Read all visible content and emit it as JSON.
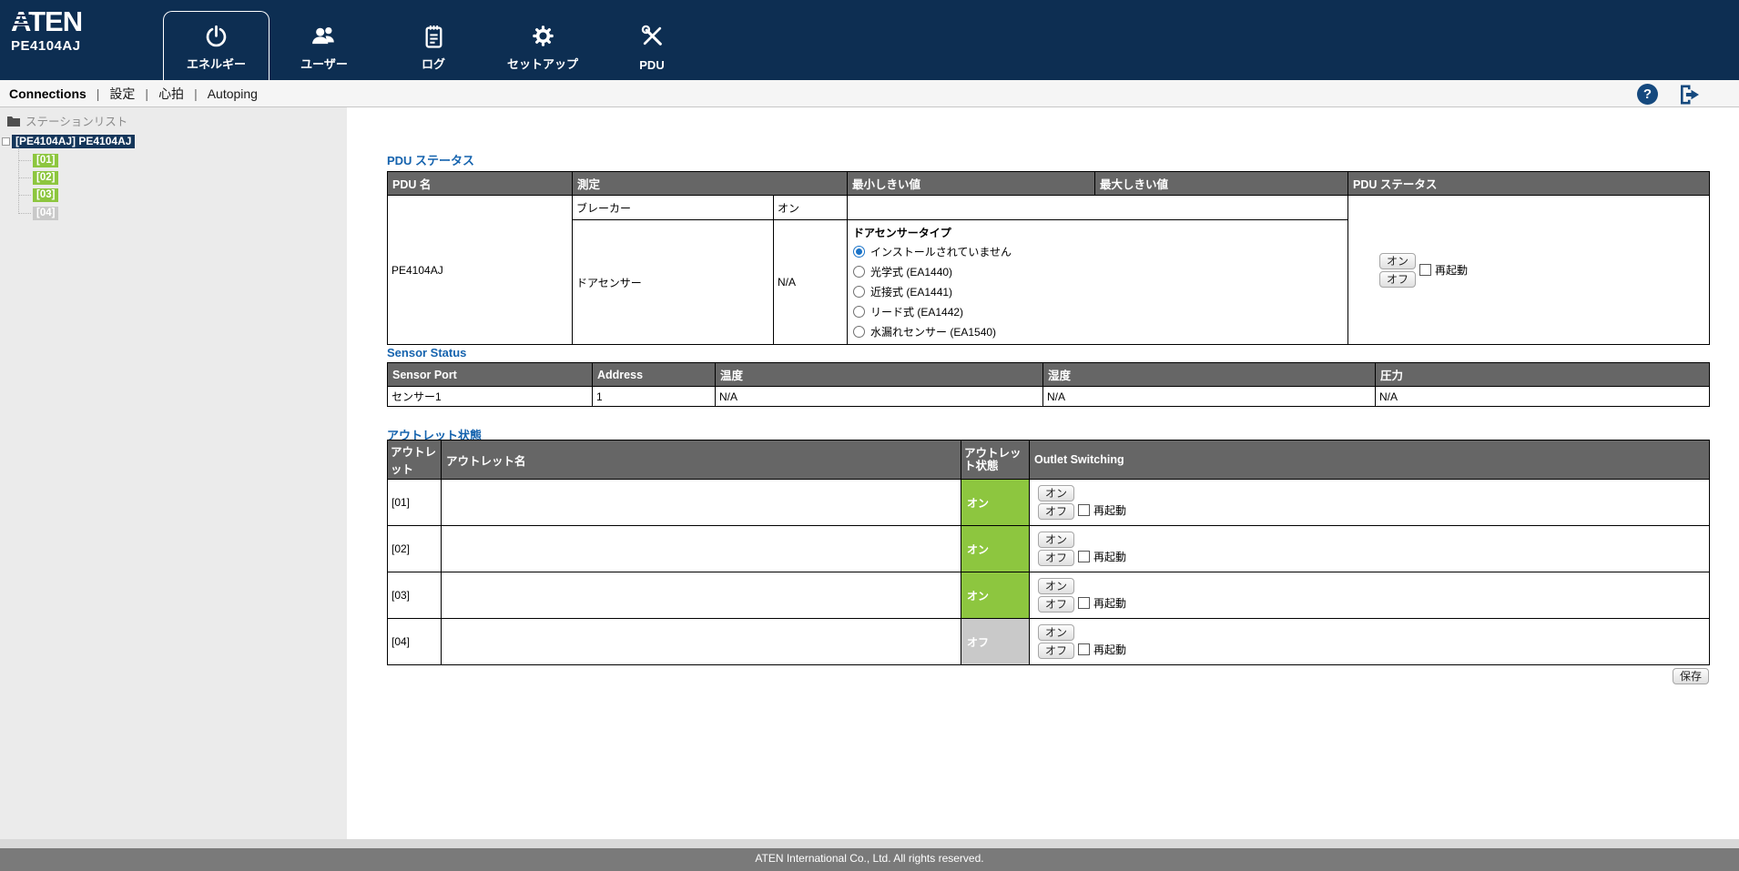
{
  "header": {
    "logo": "ATEN",
    "model": "PE4104AJ",
    "tabs": [
      {
        "label": "エネルギー",
        "icon": "power-icon",
        "active": true
      },
      {
        "label": "ユーザー",
        "icon": "users-icon",
        "active": false
      },
      {
        "label": "ログ",
        "icon": "log-icon",
        "active": false
      },
      {
        "label": "セットアップ",
        "icon": "gear-icon",
        "active": false
      },
      {
        "label": "PDU",
        "icon": "tools-icon",
        "active": false
      }
    ]
  },
  "subnav": {
    "items": [
      "Connections",
      "設定",
      "心拍",
      "Autoping"
    ],
    "active": "Connections"
  },
  "sidebar": {
    "root_label": "ステーションリスト",
    "station_label": "[PE4104AJ] PE4104AJ",
    "outlets": [
      {
        "label": "[01]",
        "state": "on"
      },
      {
        "label": "[02]",
        "state": "on"
      },
      {
        "label": "[03]",
        "state": "on"
      },
      {
        "label": "[04]",
        "state": "off"
      }
    ]
  },
  "pdu_status": {
    "title": "PDU ステータス",
    "headers": [
      "PDU 名",
      "測定",
      "最小しきい値",
      "最大しきい値",
      "PDU ステータス"
    ],
    "pdu_name": "PE4104AJ",
    "rows": [
      {
        "measure": "ブレーカー",
        "value": "オン"
      },
      {
        "measure": "ドアセンサー",
        "value": "N/A"
      }
    ],
    "door_sensor": {
      "title": "ドアセンサータイプ",
      "options": [
        "インストールされていません",
        "光学式 (EA1440)",
        "近接式 (EA1441)",
        "リード式 (EA1442)",
        "水漏れセンサー (EA1540)"
      ],
      "selected_index": 0
    },
    "controls": {
      "on": "オン",
      "off": "オフ",
      "reboot": "再起動"
    }
  },
  "sensor_status": {
    "title": "Sensor Status",
    "headers": [
      "Sensor Port",
      "Address",
      "温度",
      "湿度",
      "圧力"
    ],
    "rows": [
      [
        "センサー1",
        "1",
        "N/A",
        "N/A",
        "N/A"
      ]
    ]
  },
  "outlet_status": {
    "title": "アウトレット状態",
    "headers": [
      "アウトレット",
      "アウトレット名",
      "アウトレット状態",
      "Outlet Switching"
    ],
    "rows": [
      {
        "id": "[01]",
        "name": "",
        "state": "オン",
        "state_color": "green"
      },
      {
        "id": "[02]",
        "name": "",
        "state": "オン",
        "state_color": "green"
      },
      {
        "id": "[03]",
        "name": "",
        "state": "オン",
        "state_color": "green"
      },
      {
        "id": "[04]",
        "name": "",
        "state": "オフ",
        "state_color": "gray"
      }
    ],
    "controls": {
      "on": "オン",
      "off": "オフ",
      "reboot": "再起動"
    }
  },
  "save": {
    "label": "保存"
  },
  "footer": {
    "text": "ATEN International Co., Ltd. All rights reserved."
  },
  "colors": {
    "topbar_navy": "#0d2e52",
    "state_green": "#8dc63f",
    "state_gray": "#c9c9c9",
    "table_header_gray": "#666666",
    "title_blue": "#1563ae",
    "footer_gray": "#7a7a7a"
  }
}
